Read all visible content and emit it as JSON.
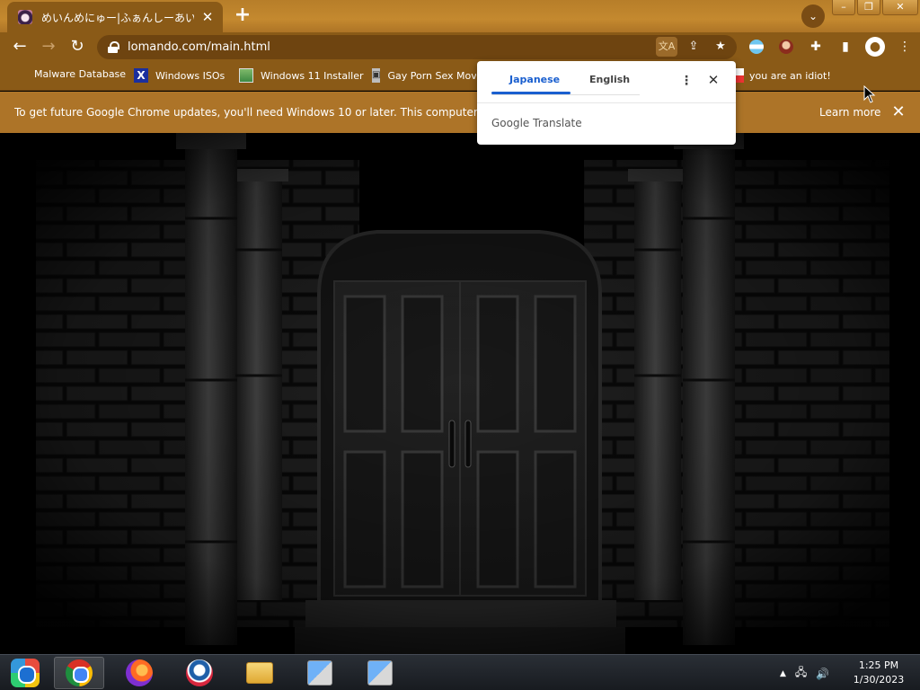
{
  "tab": {
    "title": "めいんめにゅー|ふぁんしーあいらんど",
    "close_glyph": "✕"
  },
  "new_tab_glyph": "+",
  "tab_search_glyph": "⌄",
  "window_controls": [
    "–",
    "❐",
    "✕"
  ],
  "toolbar": {
    "url": "lomando.com/main.html"
  },
  "bookmarks": [
    {
      "label": "Malware Database",
      "icon": "none"
    },
    {
      "label": "Windows ISOs",
      "icon": "x-logo"
    },
    {
      "label": "Windows 11 Installer",
      "icon": "image-icon"
    },
    {
      "label": "Gay Porn Sex Mov",
      "icon": "package-icon"
    },
    {
      "label": "you are an idiot!",
      "icon": "flag-icon"
    }
  ],
  "infobar": {
    "message": "To get future Google Chrome updates, you'll need Windows 10 or later. This computer is usi",
    "learn_more": "Learn more",
    "close_glyph": "✕"
  },
  "translate_popup": {
    "tab_source": "Japanese",
    "tab_target": "English",
    "menu_glyph": "⋮",
    "close_glyph": "✕",
    "brand_google": "Google",
    "brand_translate": "Translate"
  },
  "taskbar": {
    "time": "1:25 PM",
    "date": "1/30/2023",
    "tray_arrow": "▲",
    "network_glyph": "🖧",
    "volume_glyph": "🔊"
  },
  "colors": {
    "chrome_theme": "#8a5a17",
    "infobar": "#ad7428",
    "translate_accent": "#1a5fcf"
  }
}
